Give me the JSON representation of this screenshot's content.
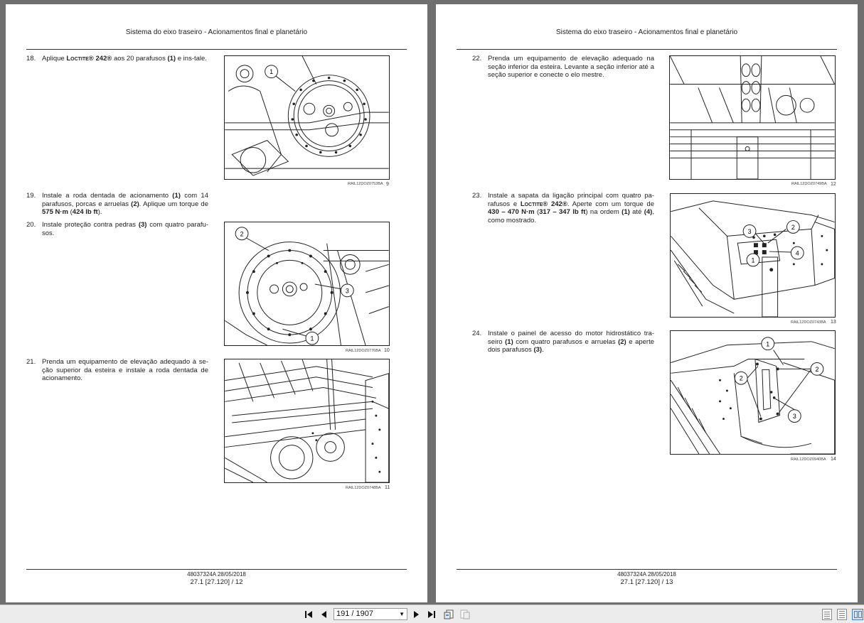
{
  "pages": [
    {
      "running_head": "Sistema do eixo traseiro - Acionamentos final e planetário",
      "footer_code": "48037324A 28/05/2018",
      "footer_page": "27.1 [27.120] / 12",
      "steps": [
        {
          "num": "18.",
          "parts": [
            "Aplique ",
            "Loctite® 242®",
            " aos 20 parafusos ",
            "(1)",
            " e ins-tale."
          ]
        },
        {
          "num": "19.",
          "parts": [
            "Instale a roda dentada de acionamento ",
            "(1)",
            " com 14 parafusos, porcas e arruelas ",
            "(2)",
            ". Aplique um torque de ",
            "575 N·m",
            " (",
            "424 lb ft",
            ")."
          ]
        },
        {
          "num": "20.",
          "parts": [
            "Instale proteção contra pedras ",
            "(3)",
            " com quatro parafu-sos."
          ]
        },
        {
          "num": "21.",
          "parts": [
            "Prenda um equipamento de elevação adequado à se-ção superior da esteira e instale a roda dentada de acionamento."
          ]
        }
      ],
      "figures": [
        {
          "code": "RAIL12DOZ0753BA",
          "num": "9",
          "callouts": [
            "1"
          ]
        },
        {
          "code": "RAIL12DOZ0776BA",
          "num": "10",
          "callouts": [
            "2",
            "3",
            "1"
          ]
        },
        {
          "code": "RAIL12DOZ0748BA",
          "num": "11",
          "callouts": []
        }
      ]
    },
    {
      "running_head": "Sistema do eixo traseiro - Acionamentos final e planetário",
      "footer_code": "48037324A 28/05/2018",
      "footer_page": "27.1 [27.120] / 13",
      "steps": [
        {
          "num": "22.",
          "parts": [
            "Prenda um equipamento de elevação adequado na seção inferior da esteira. Levante a seção inferior até a seção superior e conecte o elo mestre."
          ]
        },
        {
          "num": "23.",
          "parts": [
            "Instale a sapata da ligação principal com quatro pa-rafusos e ",
            "Loctite® 242®",
            ". Aperte com um torque de ",
            "430 – 470 N·m",
            " (",
            "317 – 347 lb ft",
            ") na ordem ",
            "(1)",
            " até ",
            "(4)",
            ", como mostrado."
          ]
        },
        {
          "num": "24.",
          "parts": [
            "Instale o painel de acesso do motor hidrostático tra-seiro ",
            "(1)",
            " com quatro parafusos e arruelas ",
            "(2)",
            " e aperte dois parafusos ",
            "(3)",
            "."
          ]
        }
      ],
      "figures": [
        {
          "code": "RAIL12DOZ0749BA",
          "num": "12",
          "callouts": []
        },
        {
          "code": "RAIL12DOZ0743BA",
          "num": "13",
          "callouts": [
            "3",
            "2",
            "1",
            "4"
          ]
        },
        {
          "code": "RAIL12DOZ0940BA",
          "num": "14",
          "callouts": [
            "1",
            "2",
            "2",
            "3"
          ]
        }
      ]
    }
  ],
  "toolbar": {
    "page_indicator": "191 / 1907",
    "icons": [
      "first-page-icon",
      "previous-page-icon",
      "next-page-icon",
      "last-page-icon",
      "go-back-view-icon",
      "go-forward-view-icon",
      "single-page-view-icon",
      "continuous-view-icon",
      "facing-pages-view-icon"
    ]
  }
}
